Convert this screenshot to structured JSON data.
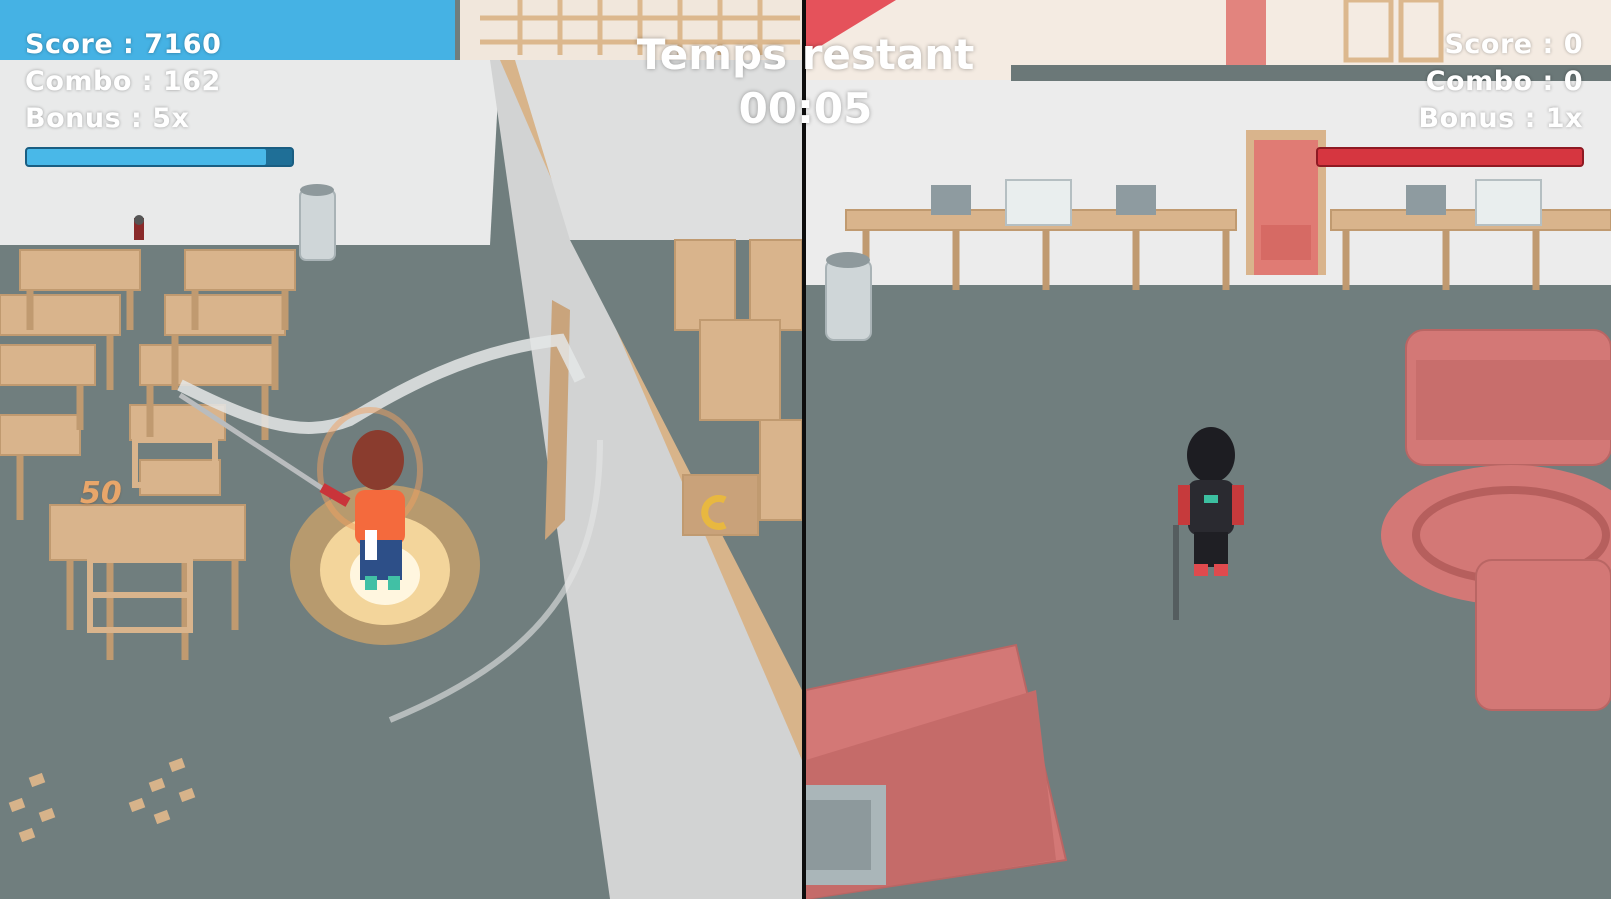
{
  "players": [
    {
      "score_text": "Score : 7160",
      "combo_text": "Combo : 162",
      "bonus_text": "Bonus : 5x",
      "color": "#49b8e8",
      "bar_fill": 0.9
    },
    {
      "score_text": "Score : 0",
      "combo_text": "Combo : 0",
      "bonus_text": "Bonus : 1x",
      "color": "#d63640",
      "bar_fill": 1.0
    }
  ],
  "timer": {
    "label": "Temps restant",
    "value": "00:05"
  },
  "floating_score": "50",
  "icons": {
    "player1_character": "boy-orange-shirt-sword-character",
    "player2_character": "girl-black-outfit-sword-character",
    "pickup": "coin-pickup-icon"
  }
}
